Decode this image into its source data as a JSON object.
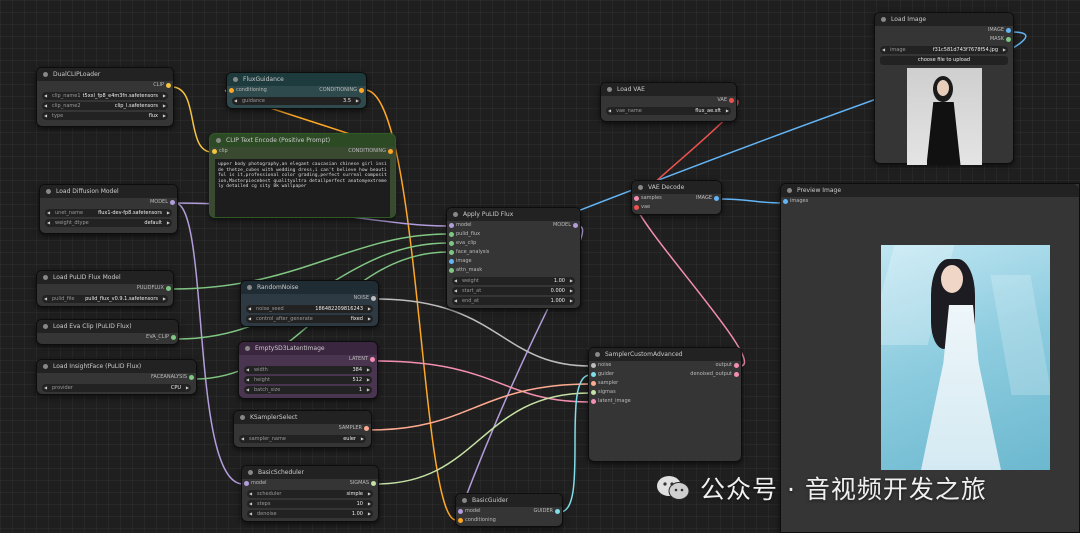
{
  "nodes": {
    "dualclip": {
      "title": "DualCLIPLoader",
      "out": "CLIP",
      "widgets": [
        {
          "label": "clip_name1",
          "value": "t5xxl_fp8_e4m3fn.safetensors"
        },
        {
          "label": "clip_name2",
          "value": "clip_l.safetensors"
        },
        {
          "label": "type",
          "value": "flux"
        }
      ]
    },
    "fluxguidance": {
      "title": "FluxGuidance",
      "in": "conditioning",
      "out": "CONDITIONING",
      "widgets": [
        {
          "label": "guidance",
          "value": "3.5"
        }
      ]
    },
    "cliptext": {
      "title": "CLIP Text Encode (Positive Prompt)",
      "in": "clip",
      "out": "CONDITIONING",
      "prompt": "upper body photography,an elegant caucasian chinese girl inside thetze_cubes with wedding dress,i can't believe how beautiful is it,professional color grading,perfect surreal composition,Masterpiecebest qualityultra detailperfect anatomyextremely detailed cg sity 8k wallpaper"
    },
    "loadimage": {
      "title": "Load Image",
      "out1": "IMAGE",
      "out2": "MASK",
      "widgets": [
        {
          "label": "image",
          "value": "f31c581d743f7678f54.jpg"
        }
      ],
      "upload": "choose file to upload"
    },
    "loadvae": {
      "title": "Load VAE",
      "out": "VAE",
      "widgets": [
        {
          "label": "vae_name",
          "value": "flux_ae.sft"
        }
      ]
    },
    "diffusion": {
      "title": "Load Diffusion Model",
      "out": "MODEL",
      "widgets": [
        {
          "label": "unet_name",
          "value": "flux1-dev-fp8.safetensors"
        },
        {
          "label": "weight_dtype",
          "value": "default"
        }
      ]
    },
    "vaedecode": {
      "title": "VAE Decode",
      "in1": "samples",
      "in2": "vae",
      "out": "IMAGE"
    },
    "preview": {
      "title": "Preview Image",
      "in": "images"
    },
    "pulid": {
      "title": "Apply PuLID Flux",
      "out": "MODEL",
      "inputs": [
        "model",
        "pulid_flux",
        "eva_clip",
        "face_analysis",
        "image",
        "attn_mask"
      ],
      "widgets": [
        {
          "label": "weight",
          "value": "1.00"
        },
        {
          "label": "start_at",
          "value": "0.000"
        },
        {
          "label": "end_at",
          "value": "1.000"
        }
      ]
    },
    "pulidmodel": {
      "title": "Load PuLID Flux Model",
      "out": "PULIDFLUX",
      "widgets": [
        {
          "label": "pulid_file",
          "value": "pulid_flux_v0.9.1.safetensors"
        }
      ]
    },
    "randomnoise": {
      "title": "RandomNoise",
      "out": "NOISE",
      "widgets": [
        {
          "label": "noise_seed",
          "value": "186482209816243"
        },
        {
          "label": "control_after_generate",
          "value": "fixed"
        }
      ]
    },
    "evaclip": {
      "title": "Load Eva Clip (PuLID Flux)",
      "out": "EVA_CLIP"
    },
    "emptylatent": {
      "title": "EmptySD3LatentImage",
      "out": "LATENT",
      "widgets": [
        {
          "label": "width",
          "value": "384"
        },
        {
          "label": "height",
          "value": "512"
        },
        {
          "label": "batch_size",
          "value": "1"
        }
      ]
    },
    "insightface": {
      "title": "Load InsightFace (PuLID Flux)",
      "out": "FACEANALYSIS",
      "widgets": [
        {
          "label": "provider",
          "value": "CPU"
        }
      ]
    },
    "sampler": {
      "title": "SamplerCustomAdvanced",
      "inputs": [
        "noise",
        "guider",
        "sampler",
        "sigmas",
        "latent_image"
      ],
      "outs": [
        "output",
        "denoised_output"
      ]
    },
    "ksamplerselect": {
      "title": "KSamplerSelect",
      "out": "SAMPLER",
      "widgets": [
        {
          "label": "sampler_name",
          "value": "euler"
        }
      ]
    },
    "basicscheduler": {
      "title": "BasicScheduler",
      "in": "model",
      "out": "SIGMAS",
      "widgets": [
        {
          "label": "scheduler",
          "value": "simple"
        },
        {
          "label": "steps",
          "value": "10"
        },
        {
          "label": "denoise",
          "value": "1.00"
        }
      ]
    },
    "basicguider": {
      "title": "BasicGuider",
      "in1": "model",
      "in2": "conditioning",
      "out": "GUIDER"
    }
  },
  "watermark": "公众号 · 音视频开发之旅",
  "colors": {
    "clip": "#f5c542",
    "model": "#b39ddb",
    "conditioning": "#ffa726",
    "image": "#64b5f6",
    "vae": "#ef5350",
    "latent": "#f48fb1",
    "noise": "#bdbdbd",
    "sampler": "#ffab91",
    "sigmas": "#c5e1a5",
    "guider": "#80deea",
    "pulid": "#81c784"
  }
}
